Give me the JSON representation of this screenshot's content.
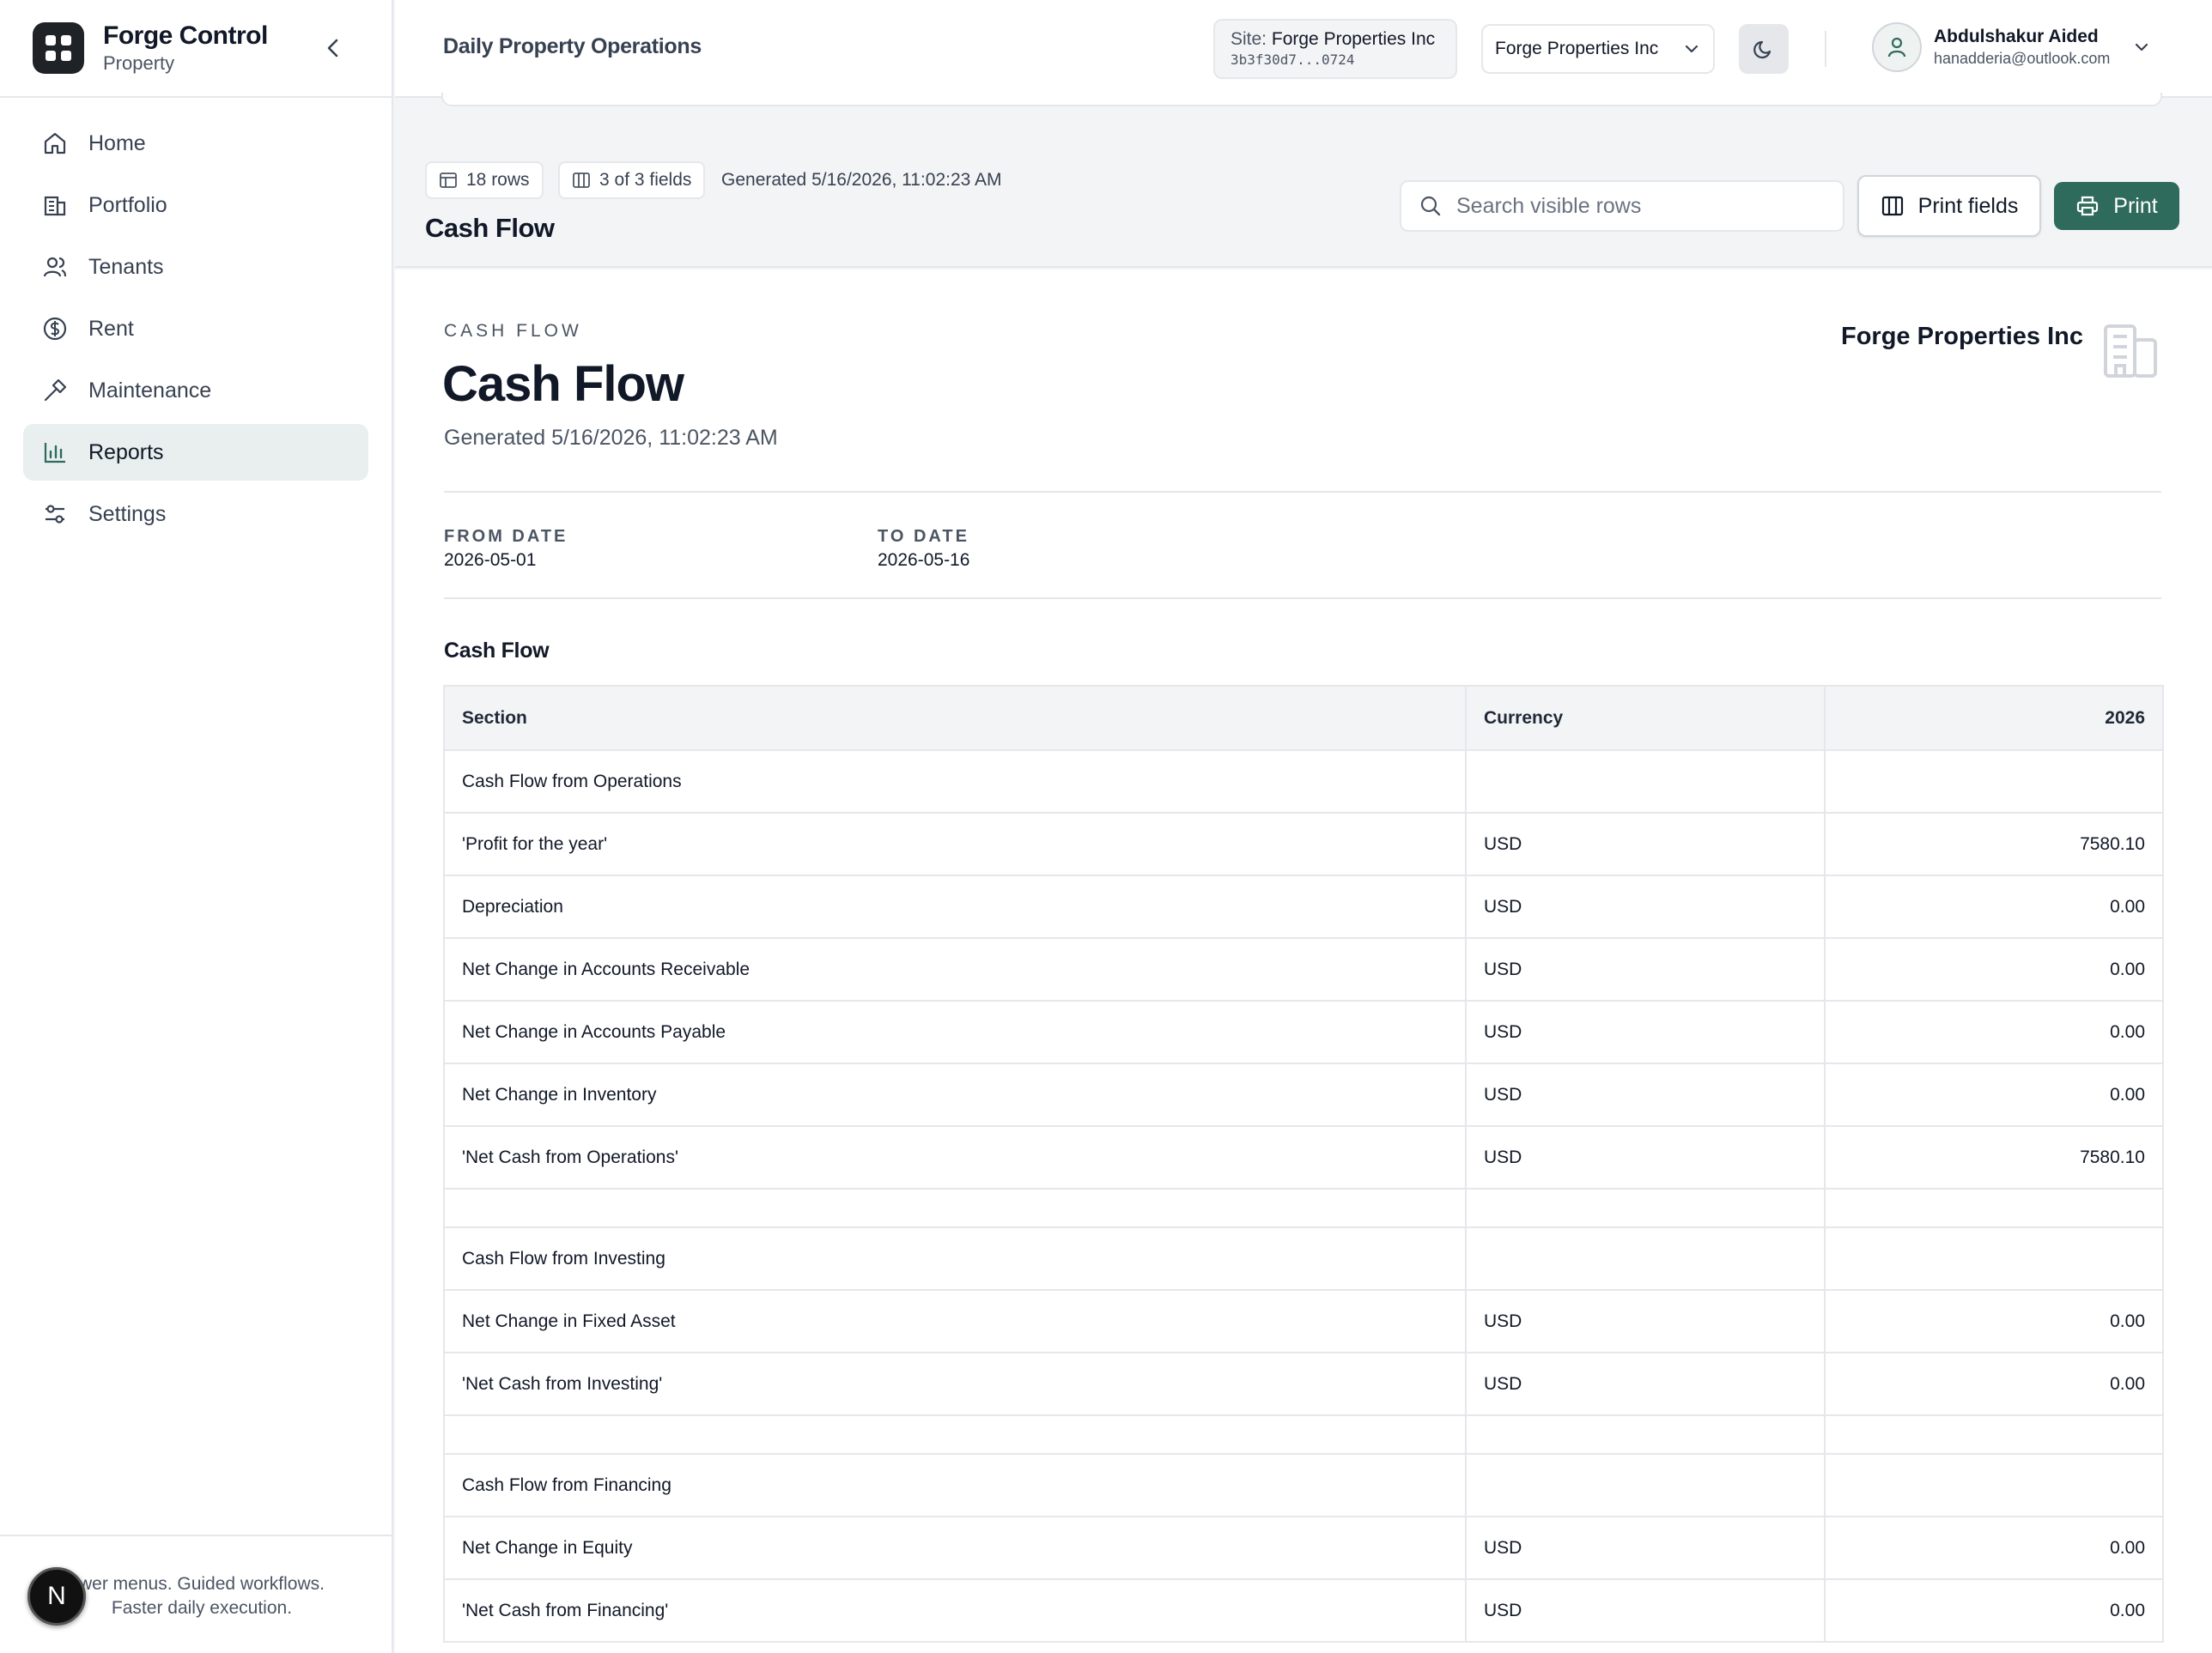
{
  "brand": {
    "name": "Forge Control",
    "sub": "Property"
  },
  "nav": [
    {
      "label": "Home",
      "icon": "home-icon"
    },
    {
      "label": "Portfolio",
      "icon": "building-icon"
    },
    {
      "label": "Tenants",
      "icon": "users-icon"
    },
    {
      "label": "Rent",
      "icon": "dollar-icon"
    },
    {
      "label": "Maintenance",
      "icon": "hammer-icon"
    },
    {
      "label": "Reports",
      "icon": "bar-chart-icon",
      "active": true
    },
    {
      "label": "Settings",
      "icon": "sliders-icon"
    }
  ],
  "sidebar_footer": {
    "line1": "wer menus. Guided workflows.",
    "line2": "Faster daily execution.",
    "badge": "N"
  },
  "header": {
    "title": "Daily Property Operations",
    "site_label": "Site:",
    "site_name": "Forge Properties Inc",
    "site_id": "3b3f30d7...0724",
    "org_select": "Forge Properties Inc",
    "user_name": "Abdulshakur Aided",
    "user_email": "hanadderia@outlook.com"
  },
  "toolbar": {
    "rows_chip": "18 rows",
    "fields_chip": "3 of 3 fields",
    "generated": "Generated 5/16/2026, 11:02:23 AM",
    "title": "Cash Flow",
    "search_placeholder": "Search visible rows",
    "print_fields_label": "Print fields",
    "print_label": "Print"
  },
  "report": {
    "eyebrow": "CASH FLOW",
    "title": "Cash Flow",
    "generated": "Generated 5/16/2026, 11:02:23 AM",
    "org": "Forge Properties Inc",
    "params": [
      {
        "label": "FROM DATE",
        "value": "2026-05-01"
      },
      {
        "label": "TO DATE",
        "value": "2026-05-16"
      }
    ],
    "section_title": "Cash Flow",
    "columns": [
      "Section",
      "Currency",
      "2026"
    ],
    "rows": [
      [
        "Cash Flow from Operations",
        "",
        ""
      ],
      [
        "'Profit for the year'",
        "USD",
        "7580.10"
      ],
      [
        "Depreciation",
        "USD",
        "0.00"
      ],
      [
        "Net Change in Accounts Receivable",
        "USD",
        "0.00"
      ],
      [
        "Net Change in Accounts Payable",
        "USD",
        "0.00"
      ],
      [
        "Net Change in Inventory",
        "USD",
        "0.00"
      ],
      [
        "'Net Cash from Operations'",
        "USD",
        "7580.10"
      ],
      [
        "",
        "",
        ""
      ],
      [
        "Cash Flow from Investing",
        "",
        ""
      ],
      [
        "Net Change in Fixed Asset",
        "USD",
        "0.00"
      ],
      [
        "'Net Cash from Investing'",
        "USD",
        "0.00"
      ],
      [
        "",
        "",
        ""
      ],
      [
        "Cash Flow from Financing",
        "",
        ""
      ],
      [
        "Net Change in Equity",
        "USD",
        "0.00"
      ],
      [
        "'Net Cash from Financing'",
        "USD",
        "0.00"
      ]
    ]
  },
  "colors": {
    "accent": "#2f6b5c",
    "active_nav": "#e8efee",
    "border": "#e5e7eb"
  }
}
